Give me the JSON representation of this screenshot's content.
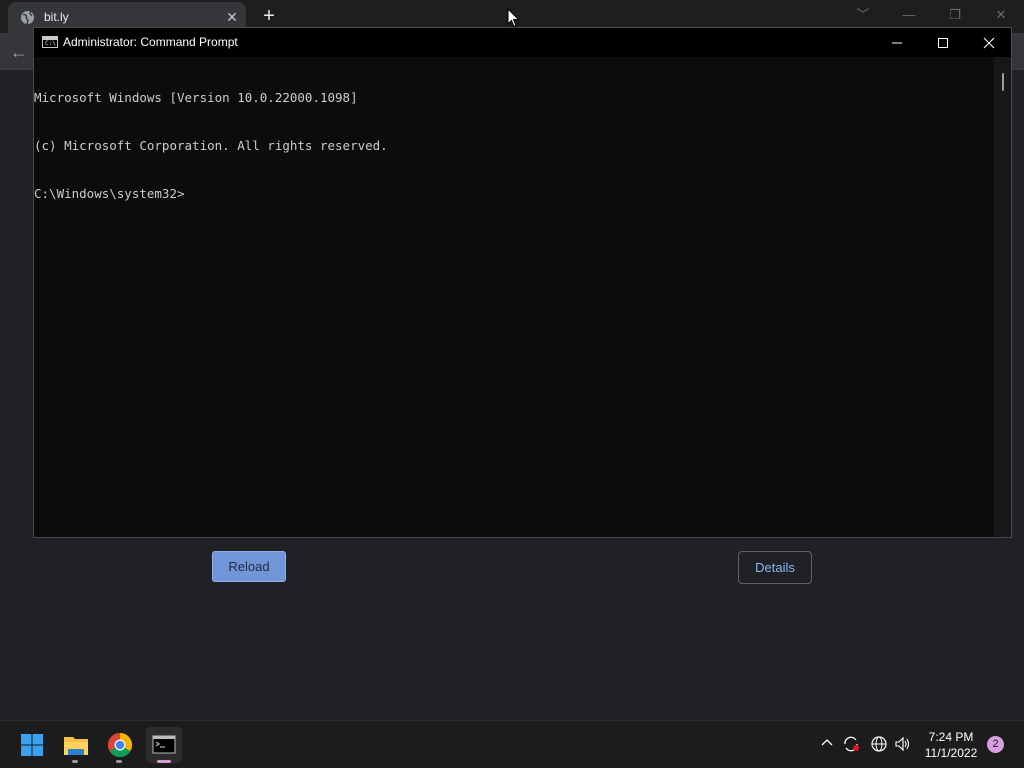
{
  "browser": {
    "tab": {
      "title": "bit.ly",
      "close_glyph": "✕",
      "icon": "globe-icon"
    },
    "new_tab_glyph": "+",
    "back_glyph": "←",
    "buttons": {
      "reload": "Reload",
      "details": "Details"
    }
  },
  "cmd": {
    "title": "Administrator: Command Prompt",
    "lines": [
      "Microsoft Windows [Version 10.0.22000.1098]",
      "(c) Microsoft Corporation. All rights reserved.",
      "C:\\Windows\\system32>"
    ]
  },
  "taskbar": {
    "apps": [
      "start-icon",
      "file-explorer-icon",
      "chrome-icon",
      "command-prompt-icon"
    ],
    "clock": {
      "time": "7:24 PM",
      "date": "11/1/2022"
    },
    "notification_count": "2"
  },
  "colors": {
    "console_bg": "#0c0c0c",
    "console_text": "#cccccc",
    "reload_button": "#7096d8",
    "details_text": "#8ab4f8",
    "notification_badge": "#d69fde"
  }
}
